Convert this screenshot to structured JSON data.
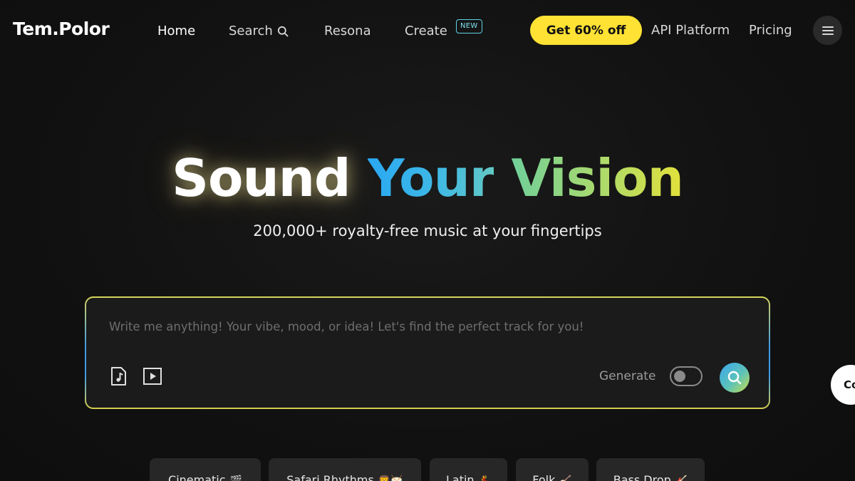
{
  "nav": {
    "logo": "Tem.Polor",
    "links": {
      "home": "Home",
      "search": "Search",
      "resona": "Resona",
      "create": "Create",
      "api": "API Platform",
      "pricing": "Pricing"
    },
    "new_badge": "NEW",
    "promo_button": "Get 60% off",
    "menu_icon": "hamburger-icon",
    "search_icon": "search-icon"
  },
  "hero": {
    "title_part1": "Sound",
    "title_part2": "Your",
    "title_part3": "Vision",
    "subtitle": "200,000+ royalty-free music at your fingertips"
  },
  "prompt": {
    "placeholder": "Write me anything! Your vibe, mood, or idea! Let's find the perfect track for you!",
    "value": "",
    "audio_icon": "music-file-icon",
    "video_icon": "video-play-icon",
    "generate_label": "Generate",
    "generate_enabled": false,
    "submit_icon": "search-icon"
  },
  "side_chat": {
    "label": "Co"
  },
  "chips": [
    {
      "label": "Cinematic",
      "emoji": "🎬"
    },
    {
      "label": "Safari Rhythms",
      "emoji": "🦁🥁"
    },
    {
      "label": "Latin",
      "emoji": "💃"
    },
    {
      "label": "Folk",
      "emoji": "🪕"
    },
    {
      "label": "Bass Drop",
      "emoji": "🎸"
    }
  ],
  "colors": {
    "background": "#121212",
    "promo": "#ffe234",
    "accent_blue": "#2aa8f2",
    "accent_yellow": "#e3e13a",
    "badge": "#5fd3e6"
  }
}
